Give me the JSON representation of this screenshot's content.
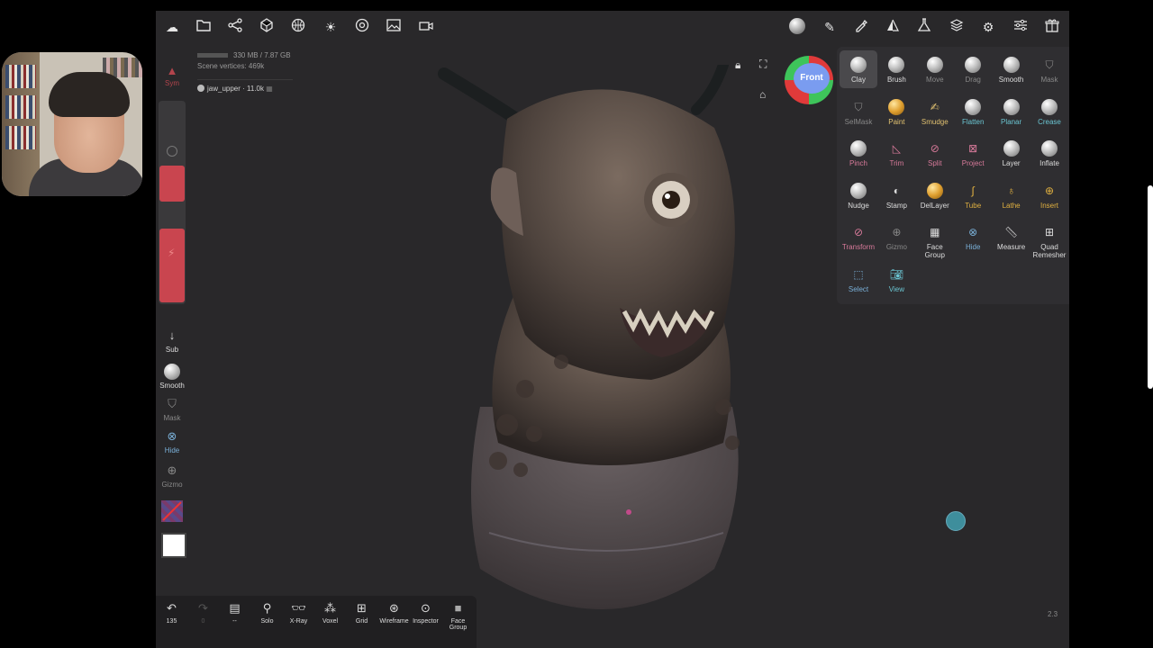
{
  "stats": {
    "memory": "330 MB / 7.87 GB",
    "vertices": "Scene vertices: 469k"
  },
  "object": {
    "name": "jaw_upper",
    "count": "11.0k"
  },
  "left": {
    "sym": "Sym",
    "sub": "Sub",
    "smooth": "Smooth",
    "mask": "Mask",
    "hide": "Hide",
    "gizmo": "Gizmo"
  },
  "cube": {
    "face": "Front"
  },
  "tools": [
    {
      "label": "Clay",
      "color": "#dddddd"
    },
    {
      "label": "Brush",
      "color": "#dddddd"
    },
    {
      "label": "Move",
      "color": "#888888"
    },
    {
      "label": "Drag",
      "color": "#888888"
    },
    {
      "label": "Smooth",
      "color": "#dddddd"
    },
    {
      "label": "Mask",
      "color": "#888888"
    },
    {
      "label": "SelMask",
      "color": "#888888"
    },
    {
      "label": "Paint",
      "color": "#e0c070"
    },
    {
      "label": "Smudge",
      "color": "#e0c070"
    },
    {
      "label": "Flatten",
      "color": "#6bc5d2"
    },
    {
      "label": "Planar",
      "color": "#6bc5d2"
    },
    {
      "label": "Crease",
      "color": "#6bc5d2"
    },
    {
      "label": "Pinch",
      "color": "#d87a9a"
    },
    {
      "label": "Trim",
      "color": "#d87a9a"
    },
    {
      "label": "Split",
      "color": "#d87a9a"
    },
    {
      "label": "Project",
      "color": "#d87a9a"
    },
    {
      "label": "Layer",
      "color": "#dddddd"
    },
    {
      "label": "Inflate",
      "color": "#dddddd"
    },
    {
      "label": "Nudge",
      "color": "#dddddd"
    },
    {
      "label": "Stamp",
      "color": "#dddddd"
    },
    {
      "label": "DelLayer",
      "color": "#dddddd"
    },
    {
      "label": "Tube",
      "color": "#e0b040"
    },
    {
      "label": "Lathe",
      "color": "#e0b040"
    },
    {
      "label": "Insert",
      "color": "#e0b040"
    },
    {
      "label": "Transform",
      "color": "#d87a9a"
    },
    {
      "label": "Gizmo",
      "color": "#888888"
    },
    {
      "label": "Face Group",
      "color": "#dddddd"
    },
    {
      "label": "Hide",
      "color": "#7ab0d8"
    },
    {
      "label": "Measure",
      "color": "#dddddd"
    },
    {
      "label": "Quad Remesher",
      "color": "#dddddd"
    },
    {
      "label": "Select",
      "color": "#7ab0d8"
    },
    {
      "label": "View",
      "color": "#6bc5d2"
    }
  ],
  "bottom": {
    "undo_count": "135",
    "redo_count": "0",
    "layer_label": "--",
    "solo": "Solo",
    "xray": "X-Ray",
    "voxel": "Voxel",
    "grid": "Grid",
    "wireframe": "Wireframe",
    "inspector": "Inspector",
    "facegroup": "Face Group"
  },
  "zoom": "2.3",
  "colors": {
    "accent_red": "#c9454f",
    "panel": "#2f2e31",
    "viewport": "#29282a"
  }
}
